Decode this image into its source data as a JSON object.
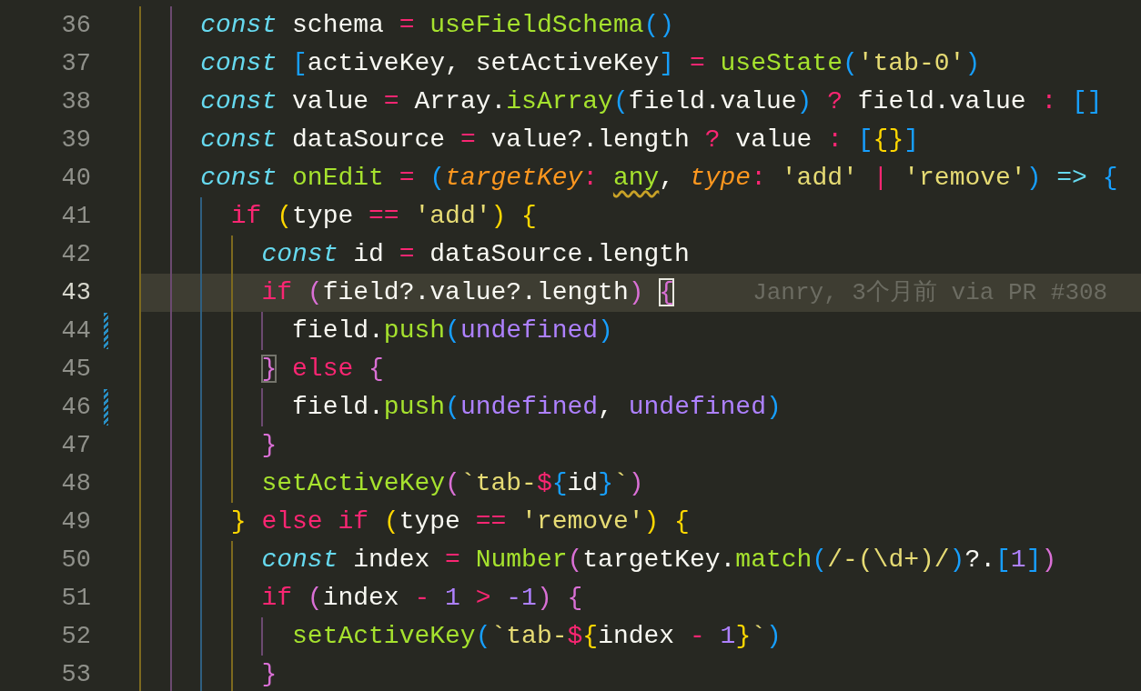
{
  "editor": {
    "lines": [
      {
        "number": "36",
        "current": false,
        "modified": false,
        "tokens": [
          {
            "text": "    const",
            "kind": "kw"
          },
          {
            "text": " schema ",
            "kind": "plain"
          },
          {
            "text": "= ",
            "kind": "op"
          },
          {
            "text": "useFieldSchema",
            "kind": "fn"
          },
          {
            "text": "()",
            "kind": "b3"
          }
        ]
      },
      {
        "number": "37",
        "current": false,
        "modified": false,
        "tokens": [
          {
            "text": "    const ",
            "kind": "kw"
          },
          {
            "text": "[",
            "kind": "b3"
          },
          {
            "text": "activeKey, setActiveKey",
            "kind": "plain"
          },
          {
            "text": "] ",
            "kind": "b3"
          },
          {
            "text": "= ",
            "kind": "op"
          },
          {
            "text": "useState",
            "kind": "fn"
          },
          {
            "text": "(",
            "kind": "b3"
          },
          {
            "text": "'tab-0'",
            "kind": "str"
          },
          {
            "text": ")",
            "kind": "b3"
          }
        ]
      },
      {
        "number": "38",
        "current": false,
        "modified": false,
        "tokens": [
          {
            "text": "    const",
            "kind": "kw"
          },
          {
            "text": " value ",
            "kind": "plain"
          },
          {
            "text": "=",
            "kind": "op"
          },
          {
            "text": " Array.",
            "kind": "plain"
          },
          {
            "text": "isArray",
            "kind": "fn"
          },
          {
            "text": "(",
            "kind": "b3"
          },
          {
            "text": "field.value",
            "kind": "plain"
          },
          {
            "text": ") ",
            "kind": "b3"
          },
          {
            "text": "?",
            "kind": "op"
          },
          {
            "text": " field.value ",
            "kind": "plain"
          },
          {
            "text": ": ",
            "kind": "op"
          },
          {
            "text": "[]",
            "kind": "b3"
          }
        ]
      },
      {
        "number": "39",
        "current": false,
        "modified": false,
        "tokens": [
          {
            "text": "    const",
            "kind": "kw"
          },
          {
            "text": " dataSource ",
            "kind": "plain"
          },
          {
            "text": "=",
            "kind": "op"
          },
          {
            "text": " value?.length ",
            "kind": "plain"
          },
          {
            "text": "?",
            "kind": "op"
          },
          {
            "text": " value ",
            "kind": "plain"
          },
          {
            "text": ": ",
            "kind": "op"
          },
          {
            "text": "[",
            "kind": "b3"
          },
          {
            "text": "{}",
            "kind": "b1"
          },
          {
            "text": "]",
            "kind": "b3"
          }
        ]
      },
      {
        "number": "40",
        "current": false,
        "modified": false,
        "tokens": [
          {
            "text": "    const ",
            "kind": "kw"
          },
          {
            "text": "onEdit ",
            "kind": "fn"
          },
          {
            "text": "= ",
            "kind": "op"
          },
          {
            "text": "(",
            "kind": "b3"
          },
          {
            "text": "targetKey",
            "kind": "param"
          },
          {
            "text": ": ",
            "kind": "op"
          },
          {
            "text": "any",
            "kind": "warn"
          },
          {
            "text": ", ",
            "kind": "plain"
          },
          {
            "text": "type",
            "kind": "param"
          },
          {
            "text": ": ",
            "kind": "op"
          },
          {
            "text": "'add' ",
            "kind": "str"
          },
          {
            "text": "| ",
            "kind": "op"
          },
          {
            "text": "'remove'",
            "kind": "str"
          },
          {
            "text": ") ",
            "kind": "b3"
          },
          {
            "text": "=> ",
            "kind": "arrow"
          },
          {
            "text": "{",
            "kind": "b3"
          }
        ]
      },
      {
        "number": "41",
        "current": false,
        "modified": false,
        "tokens": [
          {
            "text": "      if ",
            "kind": "op"
          },
          {
            "text": "(",
            "kind": "b1"
          },
          {
            "text": "type ",
            "kind": "plain"
          },
          {
            "text": "== ",
            "kind": "op"
          },
          {
            "text": "'add'",
            "kind": "str"
          },
          {
            "text": ") {",
            "kind": "b1"
          }
        ]
      },
      {
        "number": "42",
        "current": false,
        "modified": false,
        "tokens": [
          {
            "text": "        const",
            "kind": "kw"
          },
          {
            "text": " id ",
            "kind": "plain"
          },
          {
            "text": "=",
            "kind": "op"
          },
          {
            "text": " dataSource.length",
            "kind": "plain"
          }
        ]
      },
      {
        "number": "43",
        "current": true,
        "modified": false,
        "blame": "Janry, 3个月前 via PR #308",
        "tokens": [
          {
            "text": "        if ",
            "kind": "op"
          },
          {
            "text": "(",
            "kind": "b2"
          },
          {
            "text": "field?.value?.length",
            "kind": "plain"
          },
          {
            "text": ") ",
            "kind": "b2"
          },
          {
            "text": "{",
            "kind": "cursor-match"
          }
        ]
      },
      {
        "number": "44",
        "current": false,
        "modified": true,
        "tokens": [
          {
            "text": "          field.",
            "kind": "plain"
          },
          {
            "text": "push",
            "kind": "fn"
          },
          {
            "text": "(",
            "kind": "b3"
          },
          {
            "text": "undefined",
            "kind": "num"
          },
          {
            "text": ")",
            "kind": "b3"
          }
        ]
      },
      {
        "number": "45",
        "current": false,
        "modified": false,
        "tokens": [
          {
            "text": "        }",
            "kind": "match"
          },
          {
            "text": " else ",
            "kind": "op"
          },
          {
            "text": "{",
            "kind": "b2"
          }
        ]
      },
      {
        "number": "46",
        "current": false,
        "modified": true,
        "tokens": [
          {
            "text": "          field.",
            "kind": "plain"
          },
          {
            "text": "push",
            "kind": "fn"
          },
          {
            "text": "(",
            "kind": "b3"
          },
          {
            "text": "undefined",
            "kind": "num"
          },
          {
            "text": ", ",
            "kind": "plain"
          },
          {
            "text": "undefined",
            "kind": "num"
          },
          {
            "text": ")",
            "kind": "b3"
          }
        ]
      },
      {
        "number": "47",
        "current": false,
        "modified": false,
        "tokens": [
          {
            "text": "        }",
            "kind": "b2"
          }
        ]
      },
      {
        "number": "48",
        "current": false,
        "modified": false,
        "tokens": [
          {
            "text": "        setActiveKey",
            "kind": "fn"
          },
          {
            "text": "(",
            "kind": "b2"
          },
          {
            "text": "`tab-",
            "kind": "str"
          },
          {
            "text": "$",
            "kind": "op"
          },
          {
            "text": "{",
            "kind": "b3"
          },
          {
            "text": "id",
            "kind": "plain"
          },
          {
            "text": "}",
            "kind": "b3"
          },
          {
            "text": "`",
            "kind": "str"
          },
          {
            "text": ")",
            "kind": "b2"
          }
        ]
      },
      {
        "number": "49",
        "current": false,
        "modified": false,
        "tokens": [
          {
            "text": "      } ",
            "kind": "b1"
          },
          {
            "text": "else if ",
            "kind": "op"
          },
          {
            "text": "(",
            "kind": "b1"
          },
          {
            "text": "type ",
            "kind": "plain"
          },
          {
            "text": "== ",
            "kind": "op"
          },
          {
            "text": "'remove'",
            "kind": "str"
          },
          {
            "text": ") {",
            "kind": "b1"
          }
        ]
      },
      {
        "number": "50",
        "current": false,
        "modified": false,
        "tokens": [
          {
            "text": "        const",
            "kind": "kw"
          },
          {
            "text": " index ",
            "kind": "plain"
          },
          {
            "text": "= ",
            "kind": "op"
          },
          {
            "text": "Number",
            "kind": "fn"
          },
          {
            "text": "(",
            "kind": "b2"
          },
          {
            "text": "targetKey.",
            "kind": "plain"
          },
          {
            "text": "match",
            "kind": "fn"
          },
          {
            "text": "(",
            "kind": "b3"
          },
          {
            "text": "/-(\\d+)/",
            "kind": "str"
          },
          {
            "text": ")",
            "kind": "b3"
          },
          {
            "text": "?.",
            "kind": "plain"
          },
          {
            "text": "[",
            "kind": "b3"
          },
          {
            "text": "1",
            "kind": "num"
          },
          {
            "text": "]",
            "kind": "b3"
          },
          {
            "text": ")",
            "kind": "b2"
          }
        ]
      },
      {
        "number": "51",
        "current": false,
        "modified": false,
        "tokens": [
          {
            "text": "        if ",
            "kind": "op"
          },
          {
            "text": "(",
            "kind": "b2"
          },
          {
            "text": "index ",
            "kind": "plain"
          },
          {
            "text": "- ",
            "kind": "op"
          },
          {
            "text": "1 ",
            "kind": "num"
          },
          {
            "text": "> ",
            "kind": "op"
          },
          {
            "text": "-1",
            "kind": "num"
          },
          {
            "text": ") {",
            "kind": "b2"
          }
        ]
      },
      {
        "number": "52",
        "current": false,
        "modified": false,
        "tokens": [
          {
            "text": "          setActiveKey",
            "kind": "fn"
          },
          {
            "text": "(",
            "kind": "b3"
          },
          {
            "text": "`tab-",
            "kind": "str"
          },
          {
            "text": "$",
            "kind": "op"
          },
          {
            "text": "{",
            "kind": "b1"
          },
          {
            "text": "index ",
            "kind": "plain"
          },
          {
            "text": "- ",
            "kind": "op"
          },
          {
            "text": "1",
            "kind": "num"
          },
          {
            "text": "}",
            "kind": "b1"
          },
          {
            "text": "`",
            "kind": "str"
          },
          {
            "text": ")",
            "kind": "b3"
          }
        ]
      },
      {
        "number": "53",
        "current": false,
        "modified": false,
        "tokens": [
          {
            "text": "        }",
            "kind": "b2"
          }
        ]
      }
    ]
  }
}
